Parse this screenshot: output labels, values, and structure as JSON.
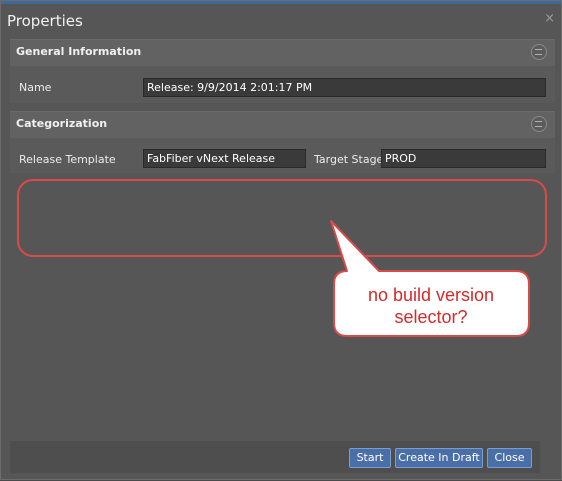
{
  "window": {
    "title": "Properties",
    "close_glyph": "×"
  },
  "general": {
    "title": "General Information",
    "name_label": "Name",
    "name_value": "Release: 9/9/2014 2:01:17 PM"
  },
  "categorization": {
    "title": "Categorization",
    "template_label": "Release Template",
    "template_value": "FabFiber vNext Release",
    "stage_label": "Target Stage",
    "stage_value": "PROD"
  },
  "callout": {
    "line1": "no build version",
    "line2": "selector?",
    "color": "#d94a4a"
  },
  "footer": {
    "start_label": "Start",
    "draft_label": "Create In Draft",
    "close_label": "Close"
  }
}
